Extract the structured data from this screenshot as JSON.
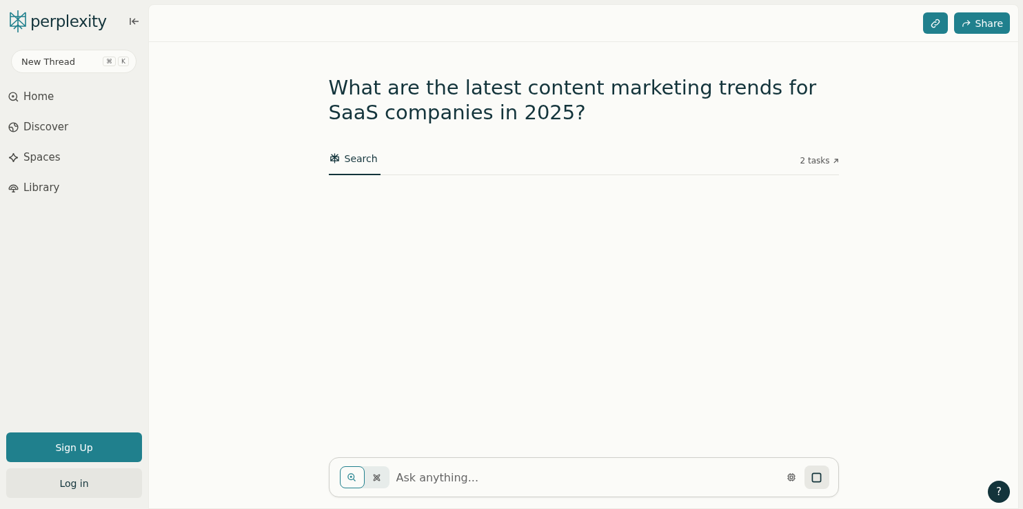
{
  "sidebar": {
    "brand": "perplexity",
    "new_thread": {
      "label": "New Thread",
      "keys": [
        "⌘",
        "K"
      ]
    },
    "nav": [
      {
        "label": "Home"
      },
      {
        "label": "Discover"
      },
      {
        "label": "Spaces"
      },
      {
        "label": "Library"
      }
    ],
    "sign_up": "Sign Up",
    "log_in": "Log in"
  },
  "header": {
    "share": "Share"
  },
  "question": "What are the latest content marketing trends for SaaS companies in 2025?",
  "tabs": [
    {
      "label": "Search",
      "selected": true
    }
  ],
  "tasks": "2 tasks",
  "composer": {
    "placeholder": "Ask anything...",
    "modes": [
      {
        "selected": true
      },
      {
        "selected": false
      }
    ]
  },
  "help": "?"
}
